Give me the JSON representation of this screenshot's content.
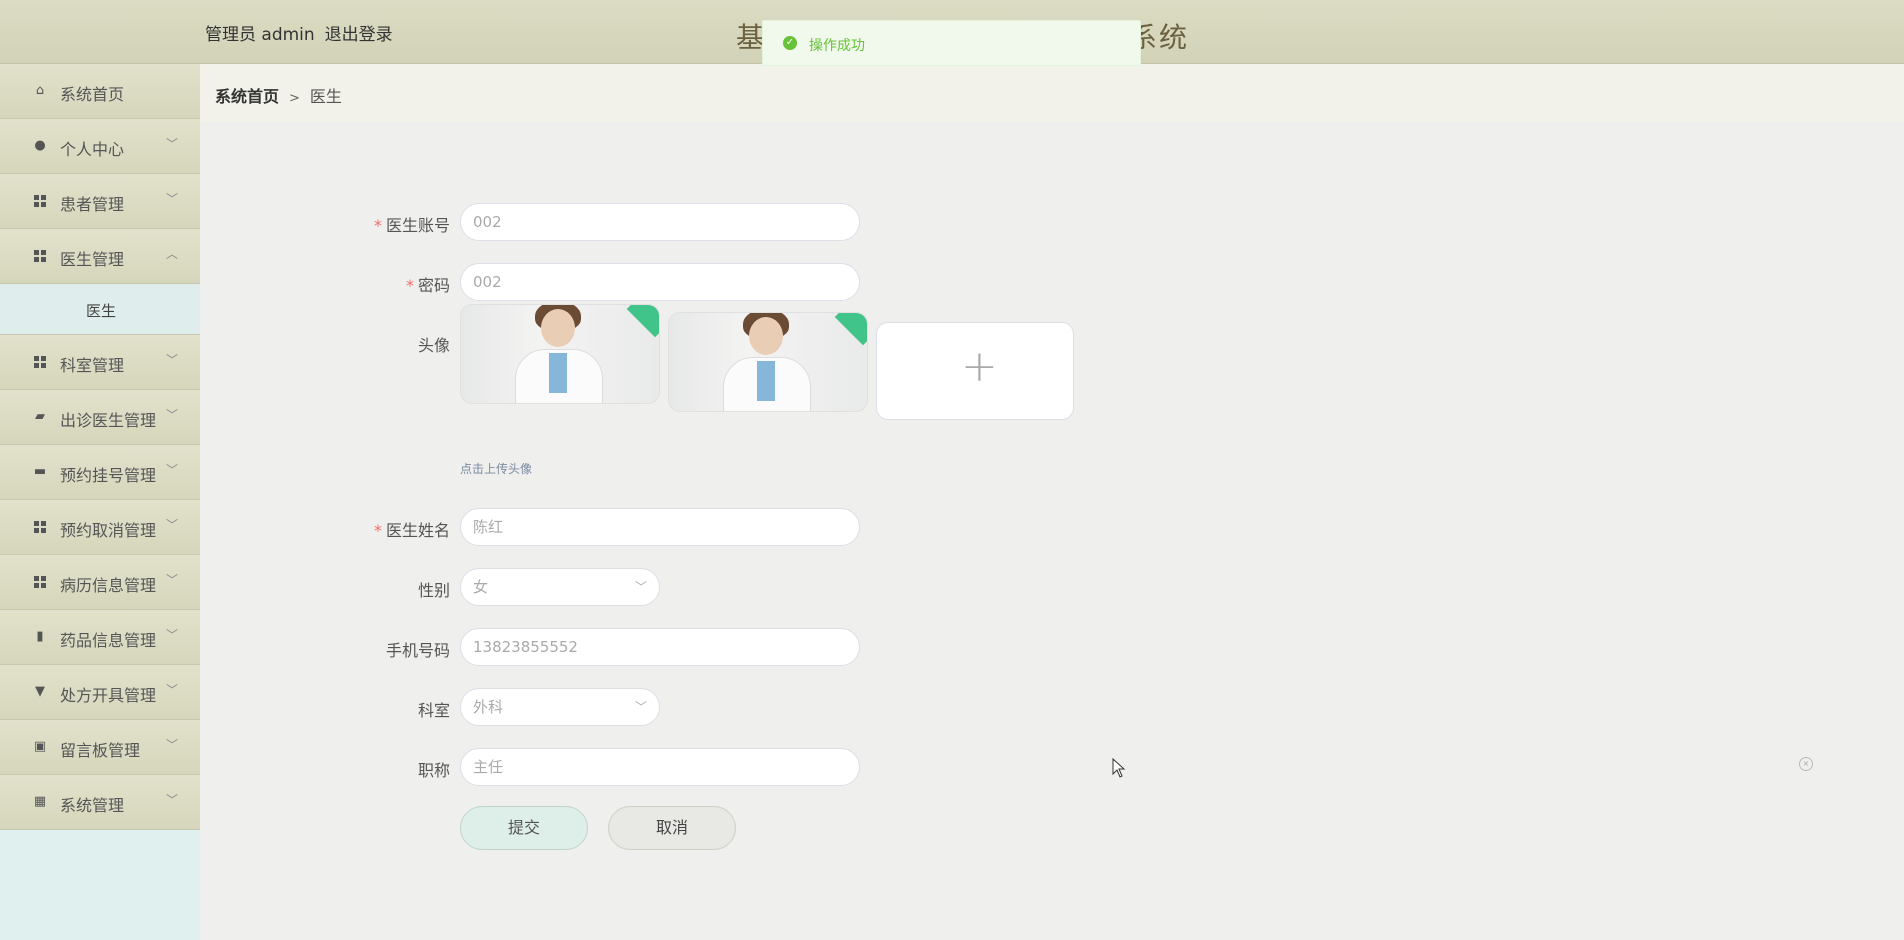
{
  "header": {
    "admin_label": "管理员 admin",
    "logout": "退出登录",
    "title_start": "基",
    "title_end": "系统"
  },
  "toast": {
    "message": "操作成功"
  },
  "sidebar": {
    "items": [
      {
        "label": "系统首页",
        "icon": "home-icon"
      },
      {
        "label": "个人中心",
        "icon": "user-icon"
      },
      {
        "label": "患者管理",
        "icon": "grid-icon"
      },
      {
        "label": "医生管理",
        "icon": "grid-icon",
        "expanded": true
      },
      {
        "label": "科室管理",
        "icon": "grid-icon"
      },
      {
        "label": "出诊医生管理",
        "icon": "briefcase-icon"
      },
      {
        "label": "预约挂号管理",
        "icon": "monitor-icon"
      },
      {
        "label": "预约取消管理",
        "icon": "grid-icon"
      },
      {
        "label": "病历信息管理",
        "icon": "grid-icon"
      },
      {
        "label": "药品信息管理",
        "icon": "clipboard-icon"
      },
      {
        "label": "处方开具管理",
        "icon": "stamp-icon"
      },
      {
        "label": "留言板管理",
        "icon": "note-icon"
      },
      {
        "label": "系统管理",
        "icon": "apps-icon"
      }
    ],
    "sub_item": "医生"
  },
  "breadcrumb": {
    "home": "系统首页",
    "separator": ">",
    "current": "医生"
  },
  "form": {
    "account_label": "医生账号",
    "account_value": "002",
    "password_label": "密码",
    "password_value": "002",
    "avatar_label": "头像",
    "avatar_hint": "点击上传头像",
    "name_label": "医生姓名",
    "name_value": "陈红",
    "gender_label": "性别",
    "gender_value": "女",
    "phone_label": "手机号码",
    "phone_value": "13823855552",
    "department_label": "科室",
    "department_value": "外科",
    "title_label": "职称",
    "title_value": "主任",
    "submit": "提交",
    "cancel": "取消"
  },
  "colors": {
    "success": "#67c23a",
    "required": "#f56c6c"
  }
}
